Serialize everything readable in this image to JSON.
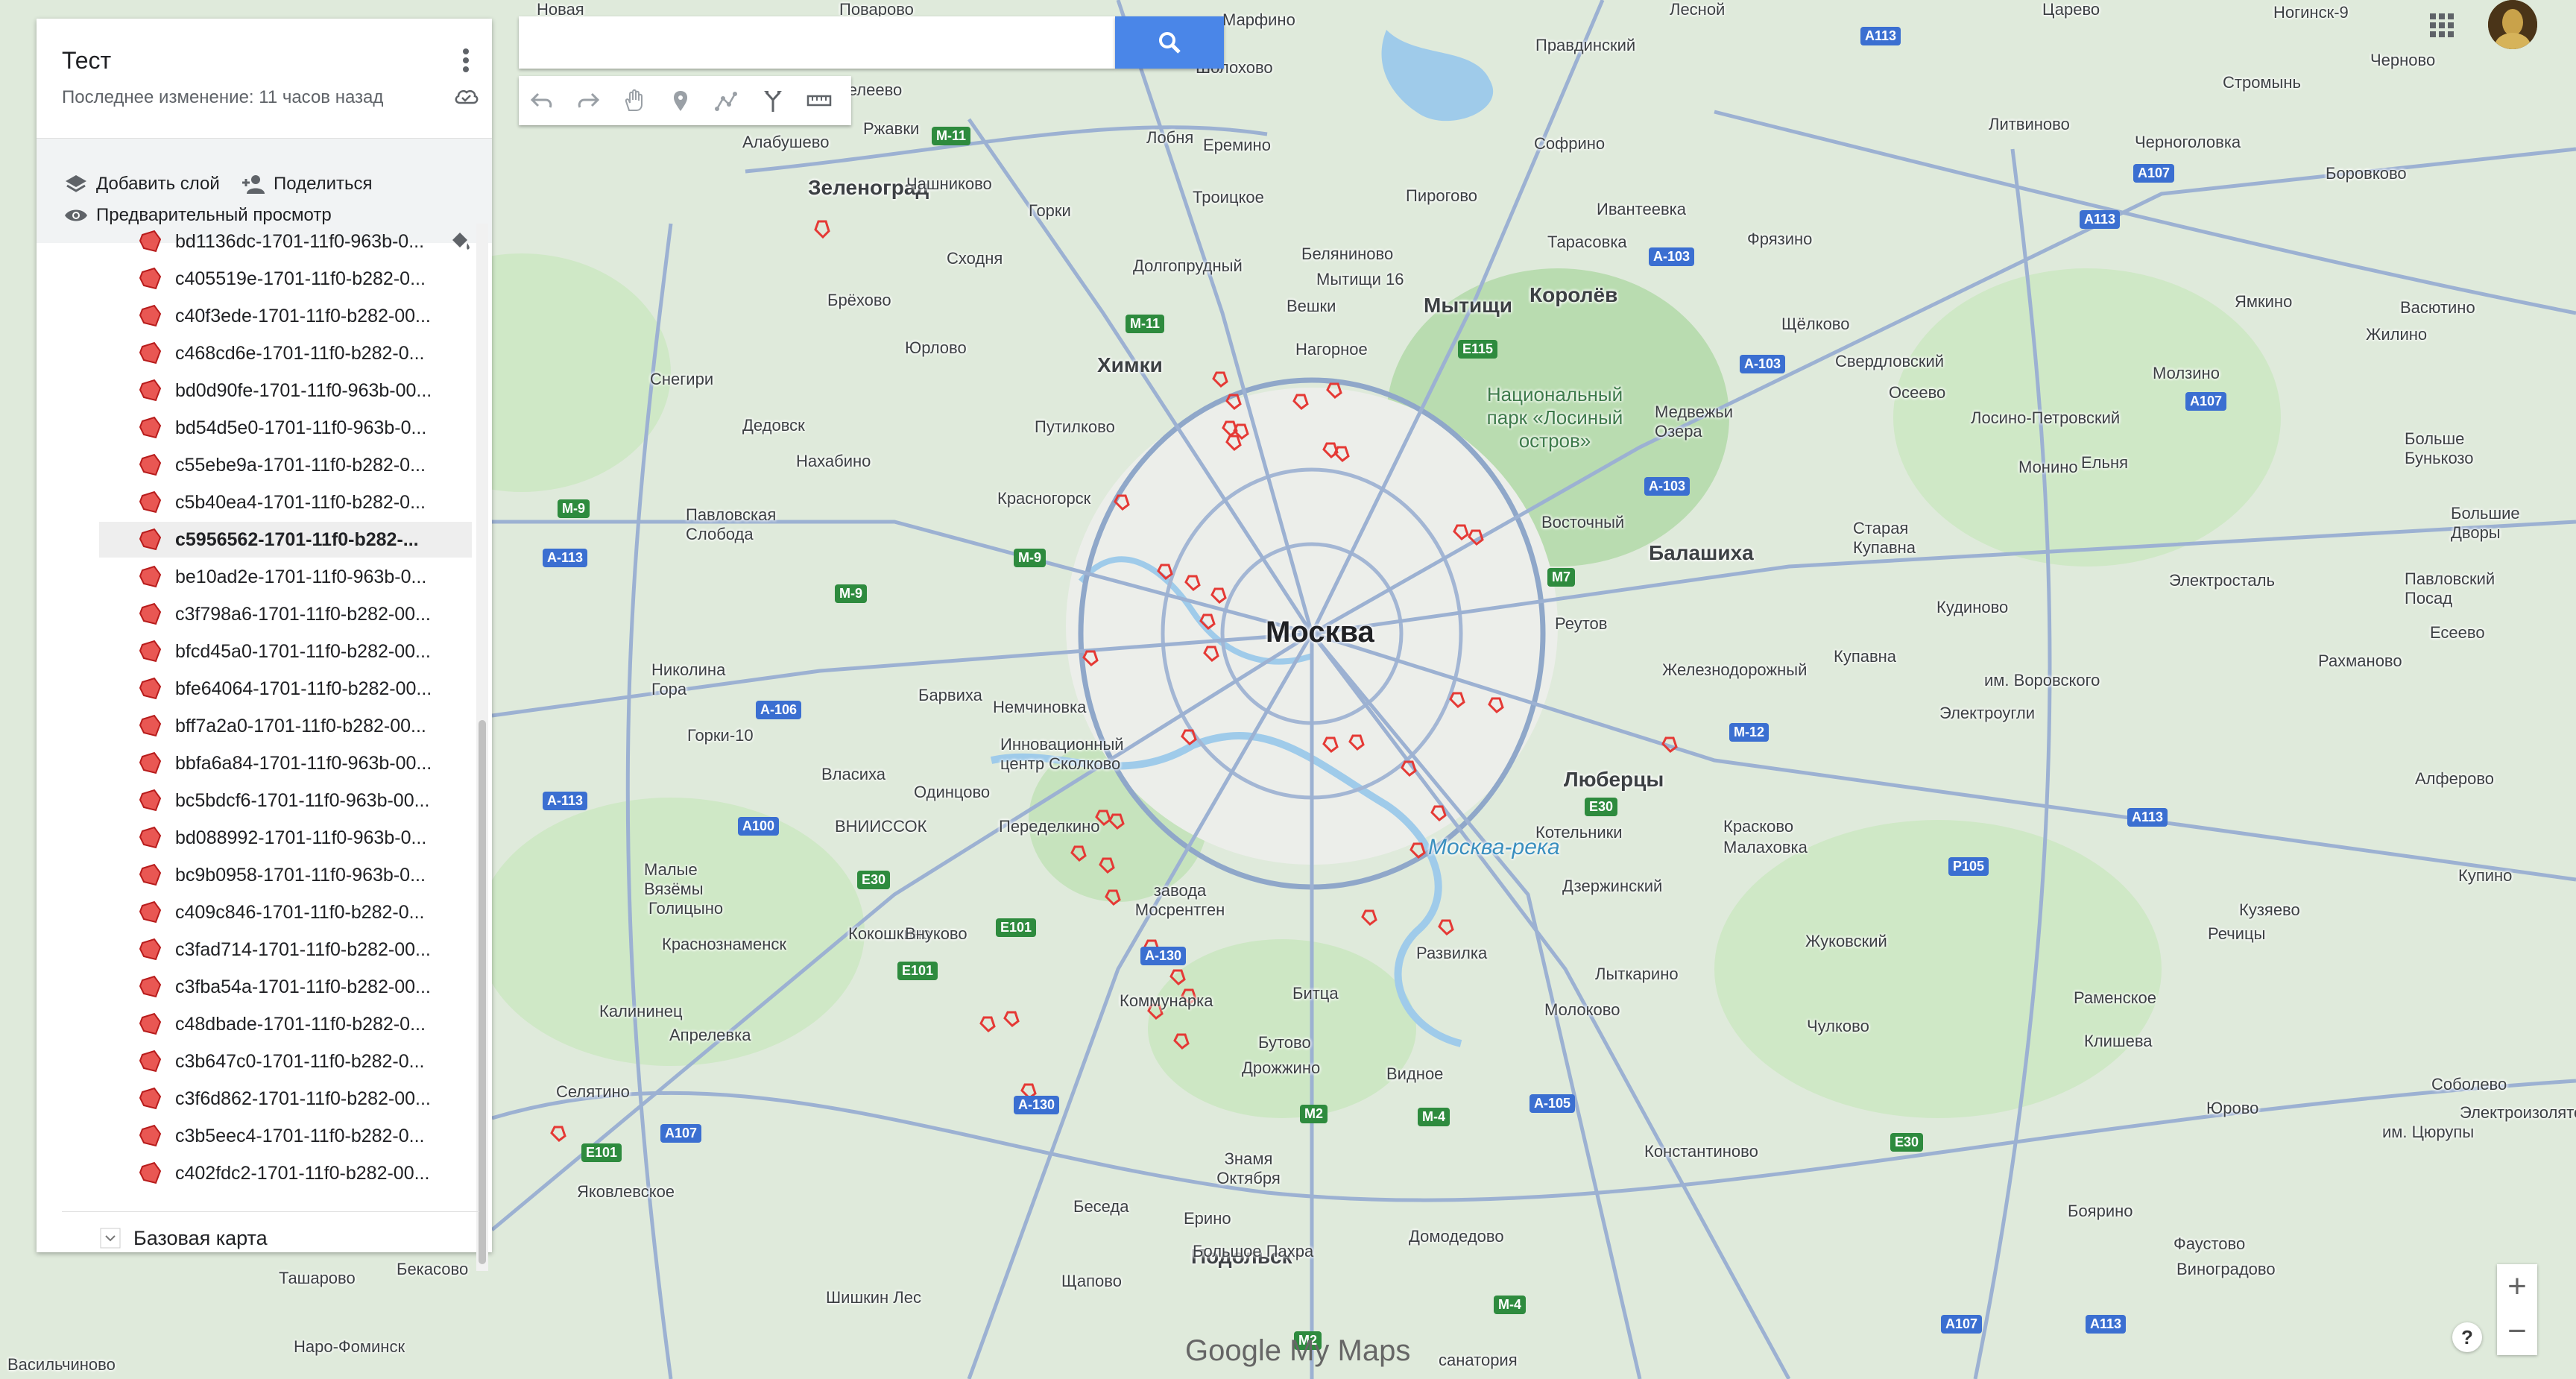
{
  "panel": {
    "title": "Тест",
    "subtitle": "Последнее изменение: 11 часов назад",
    "add_layer": "Добавить слой",
    "share": "Поделиться",
    "preview": "Предварительный просмотр",
    "basemap": "Базовая карта",
    "items": [
      {
        "label": "bd1136dc-1701-11f0-963b-0..."
      },
      {
        "label": "c405519e-1701-11f0-b282-0..."
      },
      {
        "label": "c40f3ede-1701-11f0-b282-00..."
      },
      {
        "label": "c468cd6e-1701-11f0-b282-0..."
      },
      {
        "label": "bd0d90fe-1701-11f0-963b-00..."
      },
      {
        "label": "bd54d5e0-1701-11f0-963b-0..."
      },
      {
        "label": "c55ebe9a-1701-11f0-b282-0..."
      },
      {
        "label": "c5b40ea4-1701-11f0-b282-0..."
      },
      {
        "label": "c5956562-1701-11f0-b282-..."
      },
      {
        "label": "be10ad2e-1701-11f0-963b-0..."
      },
      {
        "label": "c3f798a6-1701-11f0-b282-00..."
      },
      {
        "label": "bfcd45a0-1701-11f0-b282-00..."
      },
      {
        "label": "bfe64064-1701-11f0-b282-00..."
      },
      {
        "label": "bff7a2a0-1701-11f0-b282-00..."
      },
      {
        "label": "bbfa6a84-1701-11f0-963b-00..."
      },
      {
        "label": "bc5bdcf6-1701-11f0-963b-00..."
      },
      {
        "label": "bd088992-1701-11f0-963b-0..."
      },
      {
        "label": "bc9b0958-1701-11f0-963b-0..."
      },
      {
        "label": "c409c846-1701-11f0-b282-0..."
      },
      {
        "label": "c3fad714-1701-11f0-b282-00..."
      },
      {
        "label": "c3fba54a-1701-11f0-b282-00..."
      },
      {
        "label": "c48dbade-1701-11f0-b282-0..."
      },
      {
        "label": "c3b647c0-1701-11f0-b282-0..."
      },
      {
        "label": "c3f6d862-1701-11f0-b282-00..."
      },
      {
        "label": "c3b5eec4-1701-11f0-b282-0..."
      },
      {
        "label": "c402fdc2-1701-11f0-b282-00..."
      }
    ],
    "selected_index": 8
  },
  "search": {
    "value": ""
  },
  "map": {
    "places": [
      "Москва",
      "Химки",
      "Мытищи",
      "Королёв",
      "Балашиха",
      "Люберцы",
      "Подольск",
      "Зеленоград",
      "Новая",
      "Поварово",
      "Марфино",
      "Лесной",
      "Царево",
      "Ногинск-9",
      "Менделеево",
      "Шолохово",
      "Правдинский",
      "Черноголовка",
      "Стромынь",
      "Черново",
      "Ржавки",
      "Лобня",
      "Еремино",
      "Софрино",
      "Литвиново",
      "Алабушево",
      "Чашниково",
      "Троицкое",
      "Пирогово",
      "Ивантеевка",
      "Боровково",
      "Горки",
      "Сходня",
      "Долгопрудный",
      "Беляниново",
      "Тарасовка",
      "Фрязино",
      "Брёхово",
      "Мытищи 16",
      "Вешки",
      "Щёлково",
      "Ямкино",
      "Васютино",
      "Юрлово",
      "Нагорное",
      "Свердловский",
      "Жилино",
      "Снегири",
      "Молзино",
      "Осеево",
      "Лосино-Петровский",
      "Дедовск",
      "Путилково",
      "Медвежьи Озера",
      "Монино",
      "Ельня",
      "Нахабино",
      "Красногорск",
      "Национальный парк «Лосиный остров»",
      "Павловская Слобода",
      "Восточный",
      "Старая Купавна",
      "Электросталь",
      "Павловский Посад",
      "Реутов",
      "Кудиново",
      "Больше Бунькозо",
      "Железнодорожный",
      "Купавна",
      "им. Воровского",
      "Рахманово",
      "Николина Гора",
      "Барвиха",
      "Немчиновка",
      "Горки-10",
      "Электроугли",
      "Власиха",
      "Инновационный центр Сколково",
      "Одинцово",
      "Котельники",
      "Красково",
      "Малаховка",
      "Переделкино",
      "ВНИИССОК",
      "Малые Вязёмы",
      "завода Мосрентген",
      "Дзержинский",
      "Голицыно",
      "Кокошкино",
      "Внуково",
      "Жуковский",
      "Краснознаменск",
      "Развилка",
      "Лыткарино",
      "Раменское",
      "Кузяево",
      "Речицы",
      "Калининец",
      "Апрелевка",
      "Коммунарка",
      "Битца",
      "Молоково",
      "Чулково",
      "Клишева",
      "Бутово",
      "Видное",
      "Селятино",
      "Дрожжино",
      "Константиново",
      "Юрово",
      "Соболево",
      "им. Цюрупы",
      "Знамя Октября",
      "Ерино",
      "Домодедово",
      "Боярино",
      "Фаустово",
      "Беседа",
      "Яковлевское",
      "Бекасово",
      "Ташарово",
      "Наро-Фоминск",
      "Шишкин Лес",
      "Щапово",
      "Виноградово",
      "Васильчиново",
      "санатория",
      "Большое Пахра",
      "Алферово",
      "Купино",
      "Есеево",
      "Большие Дворы",
      "Электроизолятор",
      "Москва-река"
    ]
  },
  "zoom": {
    "in": "+",
    "out": "−"
  },
  "help": "?",
  "logo": "Google My Maps",
  "colors": {
    "accent": "#4a86e8",
    "polygon": "#e53935"
  },
  "icons": {
    "apps": "apps-grid-icon",
    "search": "search-icon"
  }
}
